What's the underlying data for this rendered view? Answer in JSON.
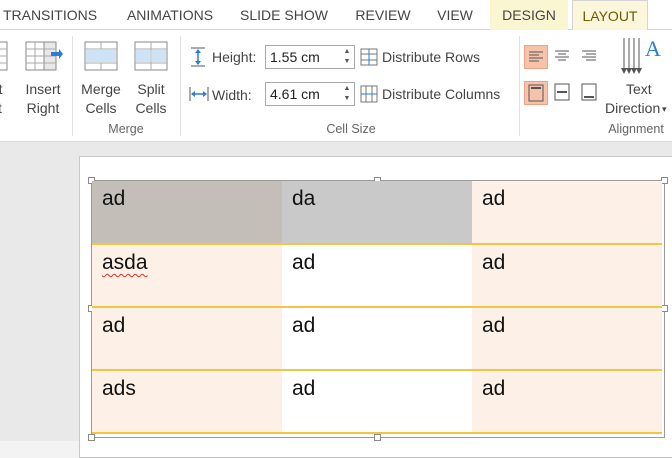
{
  "tabs": [
    "TRANSITIONS",
    "ANIMATIONS",
    "SLIDE SHOW",
    "REVIEW",
    "VIEW",
    "DESIGN",
    "LAYOUT"
  ],
  "ribbon": {
    "insert_left_partial": {
      "line1": "rt",
      "line2": "t"
    },
    "insert_right": {
      "line1": "Insert",
      "line2": "Right"
    },
    "merge_cells": {
      "line1": "Merge",
      "line2": "Cells"
    },
    "split_cells": {
      "line1": "Split",
      "line2": "Cells"
    },
    "merge_group_label": "Merge",
    "height_label": "Height:",
    "height_value": "1.55 cm",
    "width_label": "Width:",
    "width_value": "4.61 cm",
    "distribute_rows": "Distribute Rows",
    "distribute_columns": "Distribute Columns",
    "cell_size_group_label": "Cell Size",
    "text_direction": {
      "line1": "Text",
      "line2": "Direction"
    },
    "alignment_group_label": "Alignment"
  },
  "table": {
    "rows": [
      [
        "ad",
        "da",
        "ad"
      ],
      [
        "asda",
        "ad",
        "ad"
      ],
      [
        "ad",
        "ad",
        "ad"
      ],
      [
        "ads",
        "ad",
        "ad"
      ]
    ]
  },
  "colors": {
    "accent_tab": "#fcf7da",
    "row_border": "#f2c542",
    "cell_peach": "#fdf0e6",
    "cell_grey1": "#c4beb8",
    "cell_grey2": "#c9c9c9",
    "active_align": "#f6c3aa"
  }
}
